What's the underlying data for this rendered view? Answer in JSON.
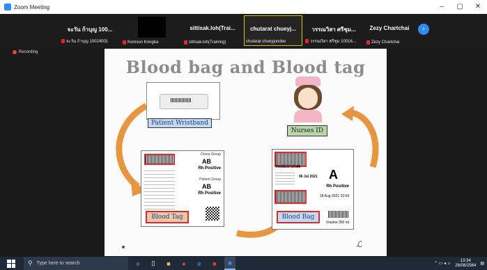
{
  "window": {
    "title": "Zoom Meeting",
    "controls": [
      "minimize",
      "maximize",
      "close"
    ]
  },
  "participants": [
    {
      "name": "จะวัน ก้าบุญ 100...",
      "sub": "จะวัน ก้าบุญ 10024001"
    },
    {
      "name": "",
      "sub": "Komsun Kongka"
    },
    {
      "name": "sittisak.loh(Trai...",
      "sub": "sittisak.loh(Training)"
    },
    {
      "name": "chutarat chueyj...",
      "sub": "chutarat chueyjundee"
    },
    {
      "name": "วรรณวิสา ศรีชุม...",
      "sub": "วรรณวิสา ศรีชุม 10016..."
    },
    {
      "name": "Zezy Chartchai",
      "sub": "Zezy Chartchai"
    }
  ],
  "recording_label": "Recording",
  "slide": {
    "title": "Blood bag and Blood tag",
    "patient_wristband": "Patient Wristband",
    "nurses_id": "Nurses ID",
    "blood_tag": "Blood Tag",
    "blood_bag": "Blood Bag",
    "tag_group_header": "Donor Group",
    "tag_group_value": "AB",
    "tag_rh": "Rh Positive",
    "tag_patient_group": "Patient Group",
    "tag_patient_value": "AB",
    "tag_patient_rh": "Rh Positive",
    "bag_code": "T500221710986",
    "bag_date": "06 Jul 2021",
    "bag_group": "A",
    "bag_rh": "Rh Positive",
    "bag_expiry": "18 Aug 2021 23:59",
    "bag_volume": "Volume 350 ml"
  },
  "taskbar": {
    "search_placeholder": "Type here to search",
    "time": "13:34",
    "date": "26/08/2564"
  },
  "colors": {
    "zoom_blue": "#2d8cff",
    "arrow_orange": "#e7963f",
    "badge_blue": "#c3d9ee",
    "badge_green": "#b9d4a7",
    "badge_tan": "#e9c9a3",
    "highlight_red": "#e0282e"
  }
}
